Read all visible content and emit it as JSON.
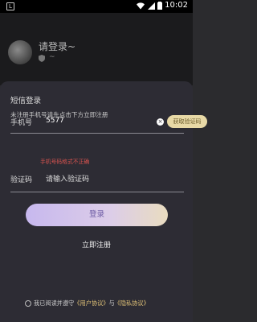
{
  "status_bar": {
    "left_badge": "L",
    "time": "10:02"
  },
  "header": {
    "login_prompt": "请登录~",
    "tilde": "~"
  },
  "sheet": {
    "title": "短信登录",
    "subtitle": "未注册手机号请先点击下方立即注册",
    "phone": {
      "label": "手机号",
      "value": "5577",
      "clear_icon": "clear-icon",
      "get_code_label": "获取验证码",
      "error": "手机号码格式不正确"
    },
    "code": {
      "label": "验证码",
      "placeholder": "请输入验证码"
    },
    "login_label": "登录",
    "register_label": "立即注册",
    "agreement": {
      "prefix": "我已阅读并遵守",
      "user_agreement": "《用户协议》",
      "and": "与",
      "privacy_agreement": "《隐私协议》"
    }
  },
  "colors": {
    "accent_gold": "#e8d9a6",
    "error_red": "#d9534f",
    "login_gradient_start": "#c7b8ee",
    "login_gradient_end": "#e9dcc0"
  }
}
